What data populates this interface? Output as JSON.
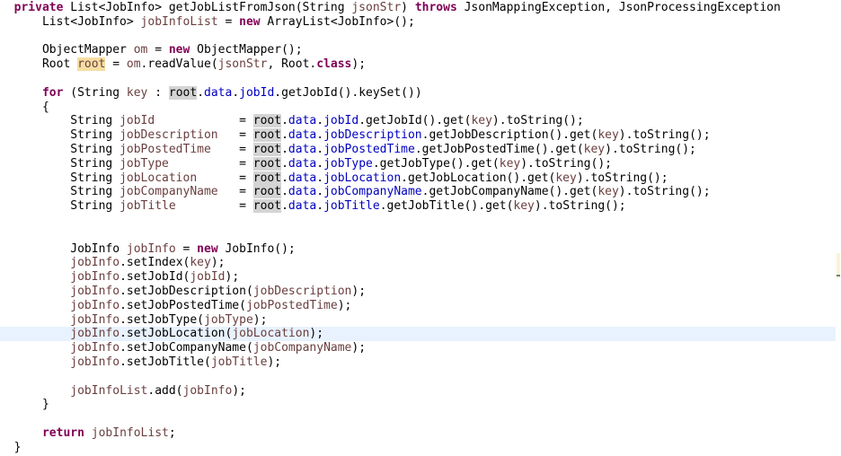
{
  "editor": {
    "language": "java",
    "highlighted_line": 23,
    "colors": {
      "keyword": "#7f0055",
      "local_variable": "#6a3e3e",
      "field": "#0000c0",
      "occurrence": "#d4d4d4",
      "write_occurrence": "#f6dea2",
      "current_line": "#e8f2fe"
    },
    "lines": [
      [
        [
          "  ",
          "p"
        ],
        [
          "private",
          "k"
        ],
        [
          " List<JobInfo> getJobListFromJson(String ",
          "p"
        ],
        [
          "jsonStr",
          "v"
        ],
        [
          ") ",
          "p"
        ],
        [
          "throws",
          "k"
        ],
        [
          " JsonMappingException, JsonProcessingException",
          "p"
        ]
      ],
      [
        [
          "      List<JobInfo> ",
          "p"
        ],
        [
          "jobInfoList",
          "v"
        ],
        [
          " = ",
          "p"
        ],
        [
          "new",
          "k"
        ],
        [
          " ArrayList<JobInfo>();",
          "p"
        ]
      ],
      [],
      [
        [
          "      ObjectMapper ",
          "p"
        ],
        [
          "om",
          "v"
        ],
        [
          " = ",
          "p"
        ],
        [
          "new",
          "k"
        ],
        [
          " ObjectMapper();",
          "p"
        ]
      ],
      [
        [
          "      Root ",
          "p"
        ],
        [
          "root",
          "vw"
        ],
        [
          " = ",
          "p"
        ],
        [
          "om",
          "v"
        ],
        [
          ".readValue(",
          "p"
        ],
        [
          "jsonStr",
          "v"
        ],
        [
          ", Root.",
          "p"
        ],
        [
          "class",
          "k"
        ],
        [
          ");",
          "p"
        ]
      ],
      [],
      [
        [
          "      ",
          "p"
        ],
        [
          "for",
          "k"
        ],
        [
          " (String ",
          "p"
        ],
        [
          "key",
          "v"
        ],
        [
          " : ",
          "p"
        ],
        [
          "root",
          "vo"
        ],
        [
          ".",
          "p"
        ],
        [
          "data",
          "f"
        ],
        [
          ".",
          "p"
        ],
        [
          "jobId",
          "f"
        ],
        [
          ".getJobId().keySet())",
          "p"
        ]
      ],
      [
        [
          "      {",
          "p"
        ]
      ],
      [
        [
          "          String ",
          "p"
        ],
        [
          "jobId",
          "v"
        ],
        [
          "            = ",
          "p"
        ],
        [
          "root",
          "vo"
        ],
        [
          ".",
          "p"
        ],
        [
          "data",
          "f"
        ],
        [
          ".",
          "p"
        ],
        [
          "jobId",
          "f"
        ],
        [
          ".getJobId().get(",
          "p"
        ],
        [
          "key",
          "v"
        ],
        [
          ").toString();",
          "p"
        ]
      ],
      [
        [
          "          String ",
          "p"
        ],
        [
          "jobDescription",
          "v"
        ],
        [
          "   = ",
          "p"
        ],
        [
          "root",
          "vo"
        ],
        [
          ".",
          "p"
        ],
        [
          "data",
          "f"
        ],
        [
          ".",
          "p"
        ],
        [
          "jobDescription",
          "f"
        ],
        [
          ".getJobDescription().get(",
          "p"
        ],
        [
          "key",
          "v"
        ],
        [
          ").toString();",
          "p"
        ]
      ],
      [
        [
          "          String ",
          "p"
        ],
        [
          "jobPostedTime",
          "v"
        ],
        [
          "    = ",
          "p"
        ],
        [
          "root",
          "vo"
        ],
        [
          ".",
          "p"
        ],
        [
          "data",
          "f"
        ],
        [
          ".",
          "p"
        ],
        [
          "jobPostedTime",
          "f"
        ],
        [
          ".getJobPostedTime().get(",
          "p"
        ],
        [
          "key",
          "v"
        ],
        [
          ").toString();",
          "p"
        ]
      ],
      [
        [
          "          String ",
          "p"
        ],
        [
          "jobType",
          "v"
        ],
        [
          "          = ",
          "p"
        ],
        [
          "root",
          "vo"
        ],
        [
          ".",
          "p"
        ],
        [
          "data",
          "f"
        ],
        [
          ".",
          "p"
        ],
        [
          "jobType",
          "f"
        ],
        [
          ".getJobType().get(",
          "p"
        ],
        [
          "key",
          "v"
        ],
        [
          ").toString();",
          "p"
        ]
      ],
      [
        [
          "          String ",
          "p"
        ],
        [
          "jobLocation",
          "v"
        ],
        [
          "      = ",
          "p"
        ],
        [
          "root",
          "vo"
        ],
        [
          ".",
          "p"
        ],
        [
          "data",
          "f"
        ],
        [
          ".",
          "p"
        ],
        [
          "jobLocation",
          "f"
        ],
        [
          ".getJobLocation().get(",
          "p"
        ],
        [
          "key",
          "v"
        ],
        [
          ").toString();",
          "p"
        ]
      ],
      [
        [
          "          String ",
          "p"
        ],
        [
          "jobCompanyName",
          "v"
        ],
        [
          "   = ",
          "p"
        ],
        [
          "root",
          "vo"
        ],
        [
          ".",
          "p"
        ],
        [
          "data",
          "f"
        ],
        [
          ".",
          "p"
        ],
        [
          "jobCompanyName",
          "f"
        ],
        [
          ".getJobCompanyName().get(",
          "p"
        ],
        [
          "key",
          "v"
        ],
        [
          ").toString();",
          "p"
        ]
      ],
      [
        [
          "          String ",
          "p"
        ],
        [
          "jobTitle",
          "v"
        ],
        [
          "         = ",
          "p"
        ],
        [
          "root",
          "vo"
        ],
        [
          ".",
          "p"
        ],
        [
          "data",
          "f"
        ],
        [
          ".",
          "p"
        ],
        [
          "jobTitle",
          "f"
        ],
        [
          ".getJobTitle().get(",
          "p"
        ],
        [
          "key",
          "v"
        ],
        [
          ").toString();",
          "p"
        ]
      ],
      [],
      [],
      [
        [
          "          JobInfo ",
          "p"
        ],
        [
          "jobInfo",
          "v"
        ],
        [
          " = ",
          "p"
        ],
        [
          "new",
          "k"
        ],
        [
          " JobInfo();",
          "p"
        ]
      ],
      [
        [
          "          ",
          "p"
        ],
        [
          "jobInfo",
          "v"
        ],
        [
          ".setIndex(",
          "p"
        ],
        [
          "key",
          "v"
        ],
        [
          ");",
          "p"
        ]
      ],
      [
        [
          "          ",
          "p"
        ],
        [
          "jobInfo",
          "v"
        ],
        [
          ".setJobId(",
          "p"
        ],
        [
          "jobId",
          "v"
        ],
        [
          ");",
          "p"
        ]
      ],
      [
        [
          "          ",
          "p"
        ],
        [
          "jobInfo",
          "v"
        ],
        [
          ".setJobDescription(",
          "p"
        ],
        [
          "jobDescription",
          "v"
        ],
        [
          ");",
          "p"
        ]
      ],
      [
        [
          "          ",
          "p"
        ],
        [
          "jobInfo",
          "v"
        ],
        [
          ".setJobPostedTime(",
          "p"
        ],
        [
          "jobPostedTime",
          "v"
        ],
        [
          ");",
          "p"
        ]
      ],
      [
        [
          "          ",
          "p"
        ],
        [
          "jobInfo",
          "v"
        ],
        [
          ".setJobType(",
          "p"
        ],
        [
          "jobType",
          "v"
        ],
        [
          ");",
          "p"
        ]
      ],
      [
        [
          "          ",
          "p"
        ],
        [
          "jobInfo",
          "v"
        ],
        [
          ".setJobLocation(",
          "p"
        ],
        [
          "jobLocation",
          "v"
        ],
        [
          ");",
          "p"
        ]
      ],
      [
        [
          "          ",
          "p"
        ],
        [
          "jobInfo",
          "v"
        ],
        [
          ".setJobCompanyName(",
          "p"
        ],
        [
          "jobCompanyName",
          "v"
        ],
        [
          ");",
          "p"
        ]
      ],
      [
        [
          "          ",
          "p"
        ],
        [
          "jobInfo",
          "v"
        ],
        [
          ".setJobTitle(",
          "p"
        ],
        [
          "jobTitle",
          "v"
        ],
        [
          ");",
          "p"
        ]
      ],
      [],
      [
        [
          "          ",
          "p"
        ],
        [
          "jobInfoList",
          "v"
        ],
        [
          ".add(",
          "p"
        ],
        [
          "jobInfo",
          "v"
        ],
        [
          ");",
          "p"
        ]
      ],
      [
        [
          "      }",
          "p"
        ]
      ],
      [],
      [
        [
          "      ",
          "p"
        ],
        [
          "return",
          "k"
        ],
        [
          " ",
          "p"
        ],
        [
          "jobInfoList",
          "v"
        ],
        [
          ";",
          "p"
        ]
      ],
      [
        [
          "  }",
          "p"
        ]
      ]
    ]
  }
}
